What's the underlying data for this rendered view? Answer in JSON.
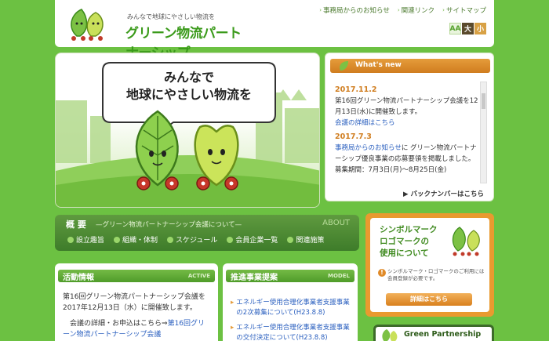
{
  "header": {
    "tagline": "みんなで地球にやさしい物流を",
    "title": "グリーン物流パートナーシップ",
    "util_links": [
      "事務局からのお知らせ",
      "関連リンク",
      "サイトマップ"
    ],
    "font_size": {
      "a": "AA",
      "large": "大",
      "small": "小"
    }
  },
  "hero": {
    "bubble_line1": "みんなで",
    "bubble_line2": "地球にやさしい物流を"
  },
  "news": {
    "title": "What's new",
    "items": [
      {
        "date": "2017.11.2",
        "text": "第16回グリーン物流パートナーシップ会議を12月13日(水)に開催致します。",
        "link": "会議の詳細はこちら"
      },
      {
        "date": "2017.7.3",
        "link": "事務局からのお知らせ",
        "text": "に グリーン物流パートナーシップ優良事業の応募要領を掲載しました。",
        "extra": "募集期間：7月3日(月)～8月25日(金)"
      }
    ],
    "backnumber": "バックナンバーはこちら"
  },
  "about": {
    "title": "概 要",
    "subtitle": "—グリーン物流パートナーシップ会議について—",
    "en": "ABOUT",
    "nav": [
      "設立趣旨",
      "組織・体制",
      "スケジュール",
      "会員企業一覧",
      "関連施策"
    ]
  },
  "activity": {
    "title": "活動情報",
    "en": "ACTIVE",
    "text1": "第16回グリーン物流パートナーシップ会議を2017年12月13日（水）に開催致します。",
    "text2": "会議の詳細・お申込はこちら⇒",
    "link": "第16回グリーン物流パートナーシップ会議"
  },
  "model": {
    "title": "推進事業提案",
    "en": "MODEL",
    "items": [
      "エネルギー使用合理化事業者支援事業の2次募集について(H23.8.8)",
      "エネルギー使用合理化事業者支援事業の交付決定について(H23.8.8)"
    ]
  },
  "symbol": {
    "title1": "シンボルマーク",
    "title2": "ロゴマークの",
    "title3": "使用について",
    "note": "シンボルマーク・ロゴマークのご利用には会員登録が必要です。",
    "button": "詳細はこちら"
  },
  "green_partnership": "Green Partnership",
  "colors": {
    "bg": "#6cc142",
    "accent": "#d07d1f",
    "green_dark": "#3e7c2a",
    "link": "#2a5fbf"
  }
}
